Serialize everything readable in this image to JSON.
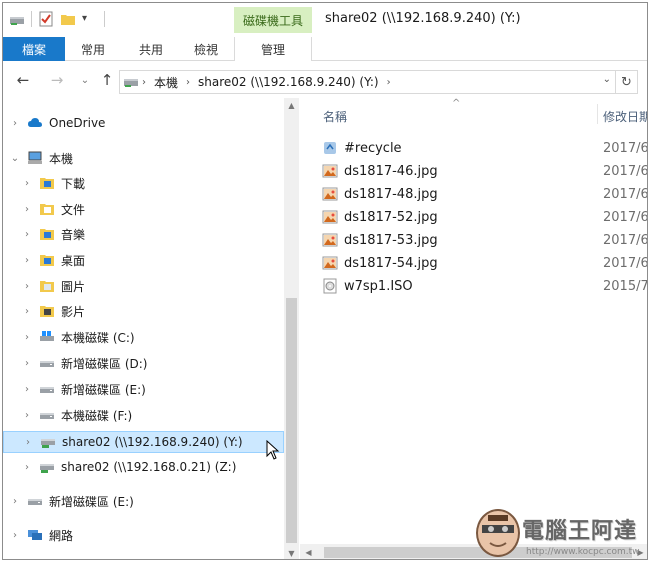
{
  "window": {
    "title": "share02 (\\\\192.168.9.240) (Y:)",
    "tool_tab": "磁碟機工具"
  },
  "ribbon": {
    "tabs": [
      "檔案",
      "常用",
      "共用",
      "檢視",
      "管理"
    ]
  },
  "address": {
    "crumbs": [
      "本機",
      "share02 (\\\\192.168.9.240) (Y:)"
    ],
    "dropdown_icon": "chevron-down-icon",
    "refresh_icon": "refresh-icon"
  },
  "nav": {
    "items": [
      {
        "label": "OneDrive",
        "icon": "cloud-icon",
        "chevron": "›",
        "level": 0
      },
      {
        "label": "本機",
        "icon": "computer-icon",
        "chevron": "⌄",
        "level": 0
      },
      {
        "label": "下載",
        "icon": "downloads-folder-icon",
        "chevron": "›",
        "level": 1
      },
      {
        "label": "文件",
        "icon": "documents-folder-icon",
        "chevron": "›",
        "level": 1
      },
      {
        "label": "音樂",
        "icon": "music-folder-icon",
        "chevron": "›",
        "level": 1
      },
      {
        "label": "桌面",
        "icon": "desktop-folder-icon",
        "chevron": "›",
        "level": 1
      },
      {
        "label": "圖片",
        "icon": "pictures-folder-icon",
        "chevron": "›",
        "level": 1
      },
      {
        "label": "影片",
        "icon": "videos-folder-icon",
        "chevron": "›",
        "level": 1
      },
      {
        "label": "本機磁碟 (C:)",
        "icon": "windows-drive-icon",
        "chevron": "›",
        "level": 1
      },
      {
        "label": "新增磁碟區 (D:)",
        "icon": "drive-icon",
        "chevron": "›",
        "level": 1
      },
      {
        "label": "新增磁碟區 (E:)",
        "icon": "drive-icon",
        "chevron": "›",
        "level": 1
      },
      {
        "label": "本機磁碟 (F:)",
        "icon": "drive-icon",
        "chevron": "›",
        "level": 1
      },
      {
        "label": "share02 (\\\\192.168.9.240) (Y:)",
        "icon": "network-drive-icon",
        "chevron": "›",
        "level": 1,
        "selected": true
      },
      {
        "label": "share02 (\\\\192.168.0.21) (Z:)",
        "icon": "network-drive-icon",
        "chevron": "›",
        "level": 1
      },
      {
        "label": "新增磁碟區 (E:)",
        "icon": "drive-icon",
        "chevron": "›",
        "level": 0
      },
      {
        "label": "網路",
        "icon": "network-icon",
        "chevron": "›",
        "level": 0
      }
    ]
  },
  "content": {
    "columns": {
      "name": "名稱",
      "date": "修改日期"
    },
    "files": [
      {
        "name": "#recycle",
        "date": "2017/6/",
        "icon": "recycle-folder-icon"
      },
      {
        "name": "ds1817-46.jpg",
        "date": "2017/6/",
        "icon": "image-file-icon"
      },
      {
        "name": "ds1817-48.jpg",
        "date": "2017/6/",
        "icon": "image-file-icon"
      },
      {
        "name": "ds1817-52.jpg",
        "date": "2017/6/",
        "icon": "image-file-icon"
      },
      {
        "name": "ds1817-53.jpg",
        "date": "2017/6/",
        "icon": "image-file-icon"
      },
      {
        "name": "ds1817-54.jpg",
        "date": "2017/6/",
        "icon": "image-file-icon"
      },
      {
        "name": "w7sp1.ISO",
        "date": "2015/7/",
        "icon": "disc-image-icon"
      }
    ]
  },
  "watermark": {
    "title": "電腦王阿達",
    "url": "http://www.kocpc.com.tw"
  },
  "colors": {
    "file_tab": "#1979ca",
    "tool_tab": "#d8efc1",
    "selection": "#cce8ff"
  }
}
